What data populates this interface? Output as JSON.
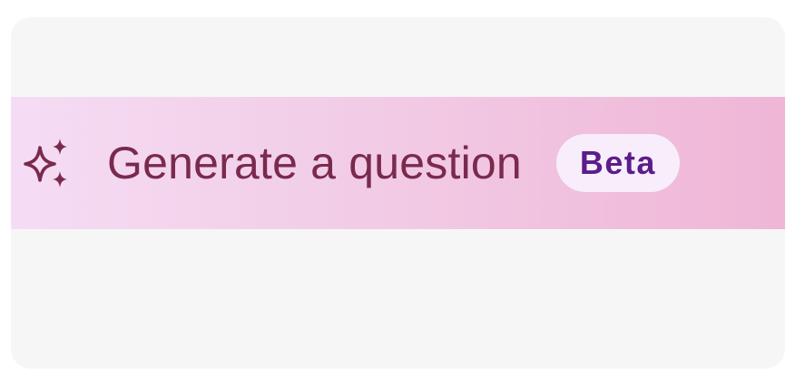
{
  "banner": {
    "icon": "sparkle-icon",
    "label": "Generate a question",
    "badge": "Beta"
  },
  "colors": {
    "card_background": "#f6f6f6",
    "gradient_start": "#f5dcf4",
    "gradient_end": "#efb6d6",
    "label_text": "#7a2a4d",
    "badge_background": "#f8eefb",
    "badge_text": "#5b1d8a"
  }
}
